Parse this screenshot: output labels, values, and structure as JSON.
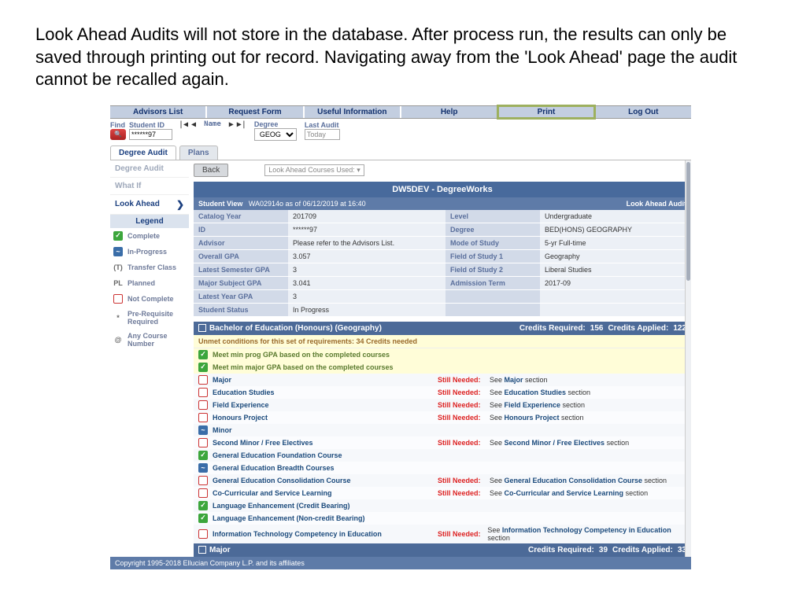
{
  "intro": "Look Ahead  Audits will not store in the database. After process run, the results can only be saved through printing out for record. Navigating away from the 'Look Ahead' page the audit cannot be recalled again.",
  "nav": {
    "advisors": "Advisors List",
    "request": "Request Form",
    "useful": "Useful Information",
    "help": "Help",
    "print": "Print",
    "logout": "Log Out"
  },
  "find": {
    "label": "Find",
    "sidLabel": "Student ID",
    "sidValue": "******97",
    "nameLabel": "Name",
    "degLabel": "Degree",
    "degValue": "GEOG",
    "lastLabel": "Last Audit",
    "lastValue": "Today"
  },
  "tabs": {
    "audit": "Degree Audit",
    "plans": "Plans"
  },
  "side": {
    "degreeAudit": "Degree Audit",
    "whatIf": "What If",
    "lookAhead": "Look Ahead",
    "legend": "Legend",
    "complete": "Complete",
    "inprog": "In-Progress",
    "transfer": "Transfer Class",
    "tIcon": "(T)",
    "planned": "Planned",
    "plIcon": "PL",
    "notComplete": "Not Complete",
    "prereq": "Pre-Requisite Required",
    "star": "*",
    "anyCourse": "Any Course Number",
    "at": "@"
  },
  "toolbar": {
    "back": "Back",
    "dd": "Look Ahead Courses Used: ▾"
  },
  "bluebar": "DW5DEV - DegreeWorks",
  "band": {
    "left": "Student View",
    "mid": "WA02914o as of 06/12/2019 at 16:40",
    "right": "Look Ahead Audit"
  },
  "info": {
    "catalogYearK": "Catalog Year",
    "catalogYearV": "201709",
    "levelK": "Level",
    "levelV": "Undergraduate",
    "idK": "ID",
    "idV": "******97",
    "degreeK": "Degree",
    "degreeV": "BED(HONS) GEOGRAPHY",
    "advisorK": "Advisor",
    "advisorV": "Please refer to the Advisors List.",
    "modeK": "Mode of Study",
    "modeV": "5-yr Full-time",
    "gpaK": "Overall GPA",
    "gpaV": "3.057",
    "fos1K": "Field of Study 1",
    "fos1V": "Geography",
    "lsgK": "Latest Semester GPA",
    "lsgV": "3",
    "fos2K": "Field of Study 2",
    "fos2V": "Liberal Studies",
    "msgK": "Major Subject GPA",
    "msgV": "3.041",
    "admK": "Admission Term",
    "admV": "2017-09",
    "lygK": "Latest Year GPA",
    "lygV": "3",
    "ssK": "Student Status",
    "ssV": "In Progress"
  },
  "sec1": {
    "title": "Bachelor of Education (Honours) (Geography)",
    "crL": "Credits Required:",
    "crV": "156",
    "caL": "Credits Applied:",
    "caV": "122"
  },
  "unmet": "Unmet conditions for this set of requirements:   34 Credits needed",
  "reqs": {
    "r1": "Meet min prog GPA based on the completed courses",
    "r2": "Meet min major GPA based on the completed courses",
    "still": "Still Needed:",
    "major": "Major",
    "majorSee": "See Major section",
    "edu": "Education Studies",
    "eduSee": "See Education Studies section",
    "field": "Field Experience",
    "fieldSee": "See Field Experience section",
    "hons": "Honours Project",
    "honsSee": "See Honours Project section",
    "minor": "Minor",
    "sminor": "Second Minor / Free Electives",
    "sminorSee": "See Second Minor / Free Electives section",
    "gef": "General Education Foundation Course",
    "geb": "General Education Breadth Courses",
    "gec": "General Education Consolidation Course",
    "gecSee": "See General Education Consolidation Course section",
    "ccsl": "Co-Curricular and Service Learning",
    "ccslSee": "See Co-Curricular and Service Learning section",
    "lecb": "Language Enhancement (Credit Bearing)",
    "lenb": "Language Enhancement (Non-credit Bearing)",
    "itce": "Information Technology Competency in Education",
    "itceSee": "See Information Technology Competency in Education section"
  },
  "sec2": {
    "title": "Major",
    "crL": "Credits Required:",
    "crV": "39",
    "caL": "Credits Applied:",
    "caV": "33"
  },
  "footer": "Copyright 1995-2018 Ellucian Company L.P. and its affiliates"
}
